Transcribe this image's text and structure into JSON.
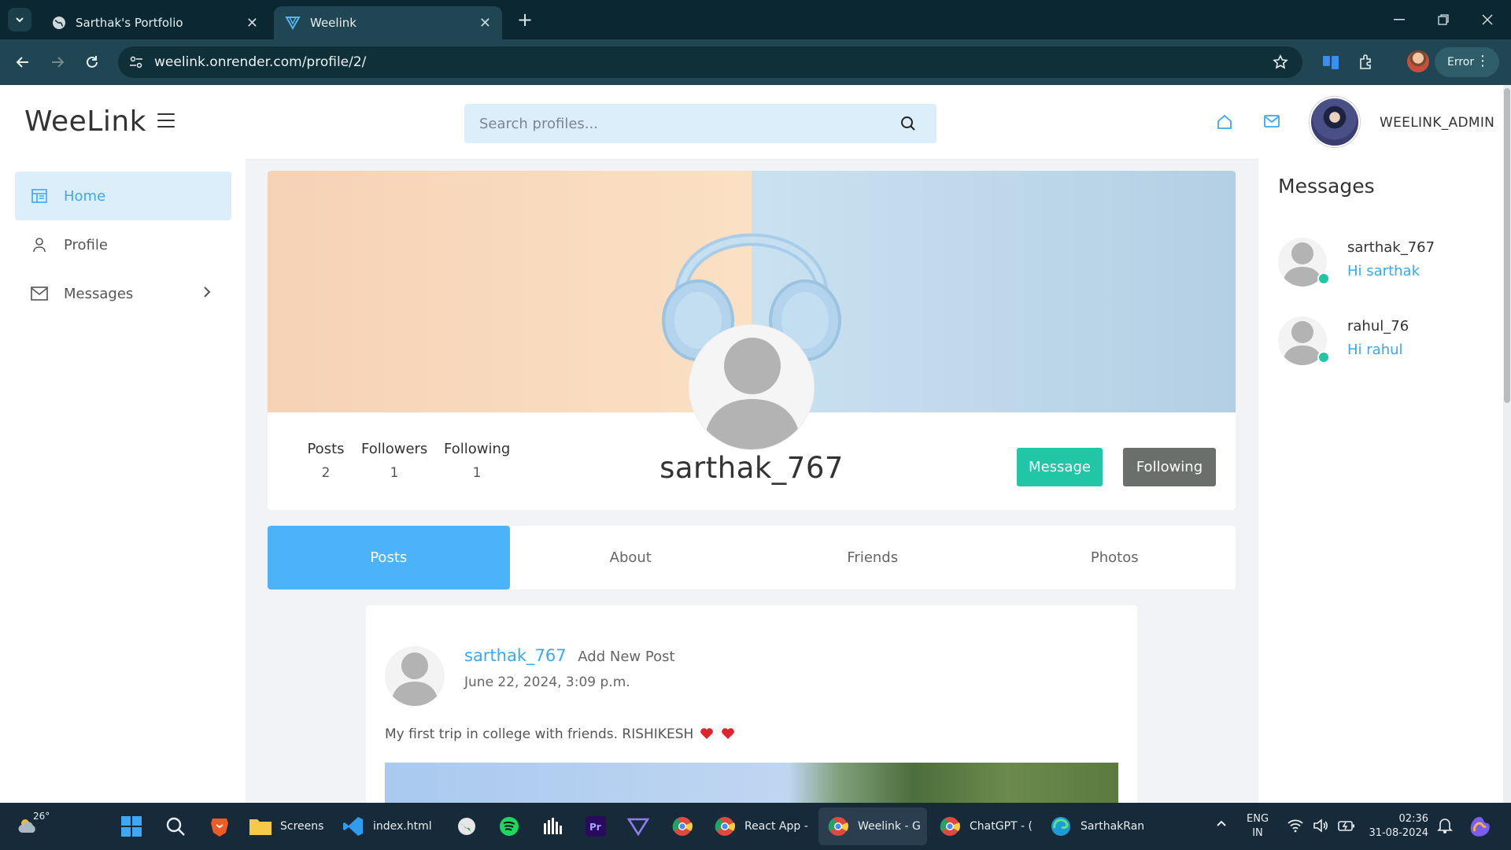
{
  "browser": {
    "tabs": [
      {
        "title": "Sarthak's Portfolio",
        "active": false
      },
      {
        "title": "Weelink",
        "active": true
      }
    ],
    "url": "weelink.onrender.com/profile/2/",
    "error_chip": "Error"
  },
  "header": {
    "logo": "WeeLink",
    "search_placeholder": "Search profiles...",
    "username": "WEELINK_ADMIN"
  },
  "sidebar": {
    "items": [
      {
        "label": "Home",
        "icon": "dashboard-icon",
        "active": true
      },
      {
        "label": "Profile",
        "icon": "user-icon",
        "active": false
      },
      {
        "label": "Messages",
        "icon": "mail-icon",
        "active": false
      }
    ]
  },
  "profile": {
    "username": "sarthak_767",
    "stats": [
      {
        "label": "Posts",
        "value": "2"
      },
      {
        "label": "Followers",
        "value": "1"
      },
      {
        "label": "Following",
        "value": "1"
      }
    ],
    "message_button": "Message",
    "following_button": "Following",
    "tabs": [
      "Posts",
      "About",
      "Friends",
      "Photos"
    ],
    "active_tab": "Posts"
  },
  "post": {
    "author": "sarthak_767",
    "action": "Add New Post",
    "date": "June 22, 2024, 3:09 p.m.",
    "text": "My first trip in college with friends. RISHIKESH"
  },
  "messages_panel": {
    "title": "Messages",
    "items": [
      {
        "name": "sarthak_767",
        "preview": "Hi sarthak",
        "online": true
      },
      {
        "name": "rahul_76",
        "preview": "Hi rahul",
        "online": true
      }
    ]
  },
  "taskbar": {
    "weather": "26°",
    "items": [
      "Screens",
      "index.html",
      "React App -",
      "Weelink - G",
      "ChatGPT - (",
      "SarthakRan"
    ],
    "lang_line1": "ENG",
    "lang_line2": "IN",
    "time": "02:36",
    "date": "31-08-2024"
  },
  "colors": {
    "accent": "#3aa8f5",
    "tab_active": "#4cb3fb",
    "teal": "#20c6a6",
    "grey_button": "#6b6f6c",
    "search_bg": "#ddeefb"
  }
}
